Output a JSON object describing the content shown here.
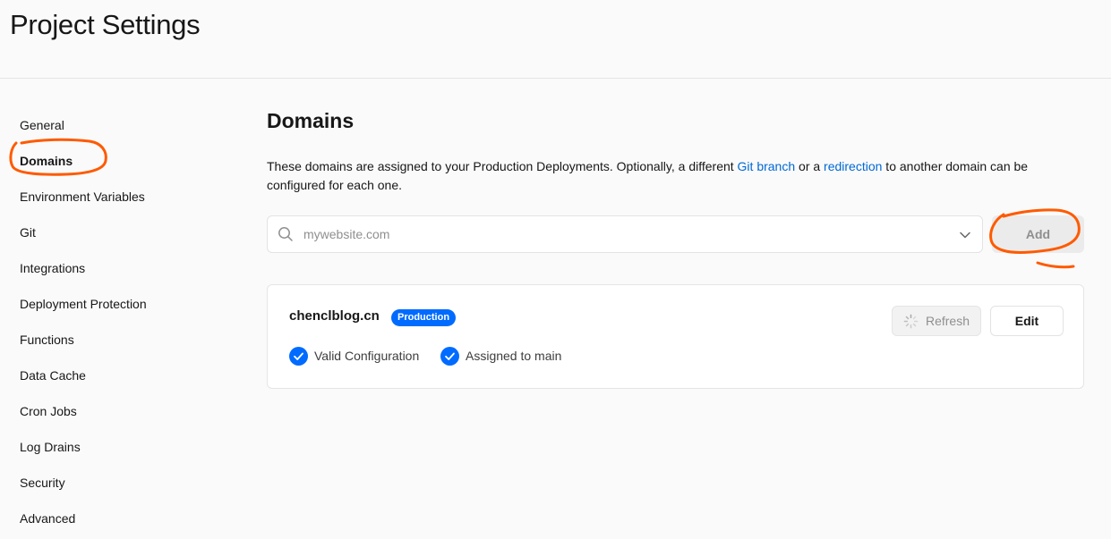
{
  "page": {
    "title": "Project Settings"
  },
  "sidebar": {
    "items": [
      {
        "label": "General",
        "active": false
      },
      {
        "label": "Domains",
        "active": true
      },
      {
        "label": "Environment Variables",
        "active": false
      },
      {
        "label": "Git",
        "active": false
      },
      {
        "label": "Integrations",
        "active": false
      },
      {
        "label": "Deployment Protection",
        "active": false
      },
      {
        "label": "Functions",
        "active": false
      },
      {
        "label": "Data Cache",
        "active": false
      },
      {
        "label": "Cron Jobs",
        "active": false
      },
      {
        "label": "Log Drains",
        "active": false
      },
      {
        "label": "Security",
        "active": false
      },
      {
        "label": "Advanced",
        "active": false
      }
    ]
  },
  "domains": {
    "title": "Domains",
    "description": {
      "part1": "These domains are assigned to your Production Deployments. Optionally, a different ",
      "link1": "Git branch",
      "part2": " or a ",
      "link2": "redirection",
      "part3": " to another domain can be configured for each one."
    },
    "search": {
      "placeholder": "mywebsite.com",
      "value": ""
    },
    "add_label": "Add",
    "items": [
      {
        "domain": "chenclblog.cn",
        "badge": "Production",
        "statuses": [
          "Valid Configuration",
          "Assigned to main"
        ],
        "refresh_label": "Refresh",
        "edit_label": "Edit"
      }
    ]
  },
  "colors": {
    "accent": "#006bff",
    "link": "#0068d6",
    "annotation": "#ff5a00"
  },
  "icons": [
    "search-icon",
    "chevron-down-icon",
    "check-circle-icon",
    "spinner-icon"
  ]
}
